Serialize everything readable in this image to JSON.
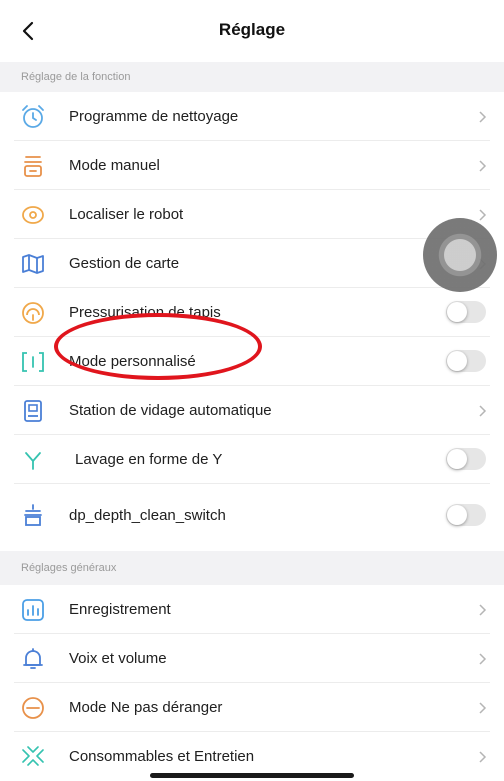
{
  "header": {
    "title": "Réglage"
  },
  "sections": [
    {
      "title": "Réglage de la fonction"
    },
    {
      "title": "Réglages généraux"
    }
  ],
  "function_items": [
    {
      "label": "Programme de nettoyage",
      "icon": "alarm-clock-icon",
      "control": "chevron"
    },
    {
      "label": "Mode manuel",
      "icon": "manual-mode-icon",
      "control": "chevron"
    },
    {
      "label": "Localiser le robot",
      "icon": "location-pin-icon",
      "control": "chevron"
    },
    {
      "label": "Gestion de carte",
      "icon": "map-icon",
      "control": "chevron"
    },
    {
      "label": "Pressurisation de tapis",
      "icon": "carpet-pressure-icon",
      "control": "toggle",
      "toggle_on": false
    },
    {
      "label": "Mode personnalisé",
      "icon": "custom-mode-icon",
      "control": "toggle",
      "toggle_on": false
    },
    {
      "label": "Station de vidage automatique",
      "icon": "dock-station-icon",
      "control": "chevron"
    },
    {
      "label": "Lavage en forme de Y",
      "icon": "y-shape-icon",
      "control": "toggle",
      "toggle_on": false
    },
    {
      "label": "dp_depth_clean_switch",
      "icon": "depth-clean-icon",
      "control": "toggle",
      "toggle_on": false
    }
  ],
  "general_items": [
    {
      "label": "Enregistrement",
      "icon": "record-chart-icon",
      "control": "chevron"
    },
    {
      "label": "Voix et volume",
      "icon": "bell-icon",
      "control": "chevron"
    },
    {
      "label": "Mode Ne pas déranger",
      "icon": "do-not-disturb-icon",
      "control": "chevron"
    },
    {
      "label": "Consommables et Entretien",
      "icon": "consumables-icon",
      "control": "chevron"
    }
  ],
  "colors": {
    "accent_blue": "#4a90e2",
    "accent_orange": "#f0a050",
    "highlight_red": "#e0151d",
    "toggle_off": "#e6e6e6"
  }
}
